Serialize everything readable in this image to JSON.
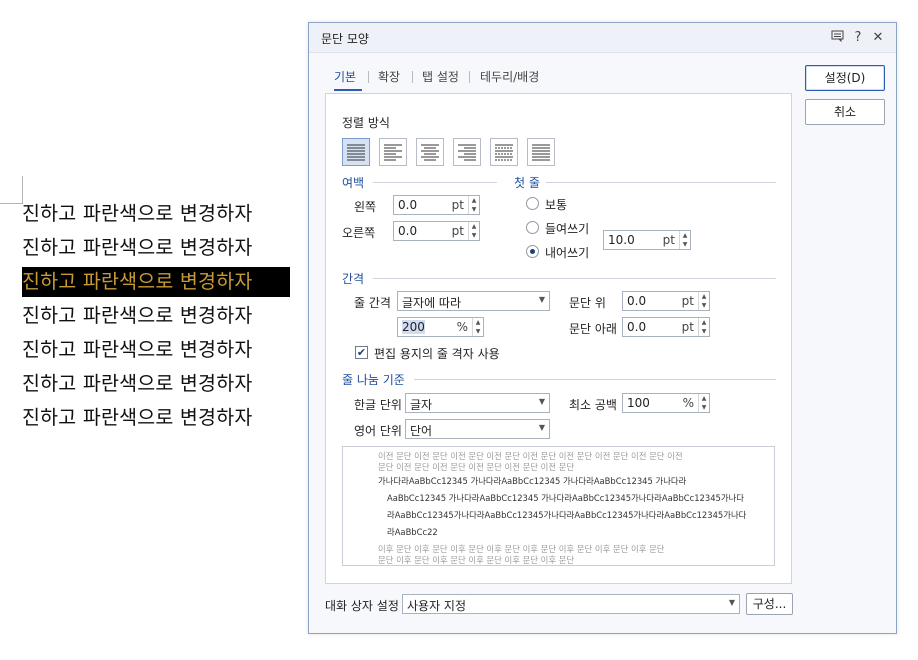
{
  "document": {
    "lines": [
      "진하고 파란색으로 변경하자",
      "진하고 파란색으로 변경하자",
      "진하고 파란색으로 변경하자",
      "진하고 파란색으로 변경하자",
      "진하고 파란색으로 변경하자",
      "진하고 파란색으로 변경하자",
      "진하고 파란색으로 변경하자"
    ],
    "selected_index": 2
  },
  "dialog": {
    "title": "문단 모양",
    "titlebar_icons": {
      "help": "?",
      "close": "✕"
    },
    "tabs": [
      "기본",
      "확장",
      "탭 설정",
      "테두리/배경"
    ],
    "active_tab": "기본",
    "buttons": {
      "ok": "설정(D)",
      "cancel": "취소",
      "config": "구성..."
    },
    "alignment": {
      "title": "정렬 방식",
      "icons": [
        "align-justify-icon",
        "align-left-icon",
        "align-center-icon",
        "align-right-icon",
        "align-distribute-icon",
        "align-split-icon"
      ],
      "active": 0
    },
    "margin": {
      "title": "여백",
      "left_label": "왼쪽",
      "left_value": "0.0",
      "left_unit": "pt",
      "right_label": "오른쪽",
      "right_value": "0.0",
      "right_unit": "pt"
    },
    "first_line": {
      "title": "첫 줄",
      "options": [
        "보통",
        "들여쓰기",
        "내어쓰기"
      ],
      "selected": 2,
      "value": "10.0",
      "unit": "pt"
    },
    "spacing": {
      "title": "간격",
      "line_spacing_label": "줄 간격",
      "line_spacing_type": "글자에 따라",
      "line_spacing_value": "200",
      "line_spacing_unit": "%",
      "before_label": "문단 위",
      "before_value": "0.0",
      "before_unit": "pt",
      "after_label": "문단 아래",
      "after_value": "0.0",
      "after_unit": "pt",
      "grid_label": "편집 용지의 줄 격자 사용",
      "grid_checked": true,
      "check_mark": "✔"
    },
    "line_break": {
      "title": "줄 나눔 기준",
      "korean_label": "한글 단위",
      "korean_value": "글자",
      "english_label": "영어 단위",
      "english_value": "단어",
      "min_space_label": "최소 공백",
      "min_space_value": "100",
      "min_space_unit": "%"
    },
    "preview": {
      "before_lines": [
        "이전 문단 이전 문단 이전 문단 이전 문단 이전 문단 이전 문단 이전 문단 이전 문단 이전",
        "문단 이전 문단 이전 문단 이전 문단 이전 문단 이전 문단"
      ],
      "body_lines": [
        "가나다라AaBbCc12345      가나다라AaBbCc12345      가나다라AaBbCc12345      가나다라",
        "AaBbCc12345  가나다라AaBbCc12345  가나다라AaBbCc12345가나다라AaBbCc12345가나다",
        "라AaBbCc12345가나다라AaBbCc12345가나다라AaBbCc12345가나다라AaBbCc12345가나다",
        "라AaBbCc22"
      ],
      "after_lines": [
        "이후 문단 이후 문단 이후 문단 이후 문단 이후 문단 이후 문단 이후 문단 이후 문단",
        "문단 이후 문단 이후 문단 이후 문단 이후 문단 이후 문단"
      ]
    },
    "footer": {
      "label": "대화 상자 설정",
      "value": "사용자 지정"
    }
  }
}
